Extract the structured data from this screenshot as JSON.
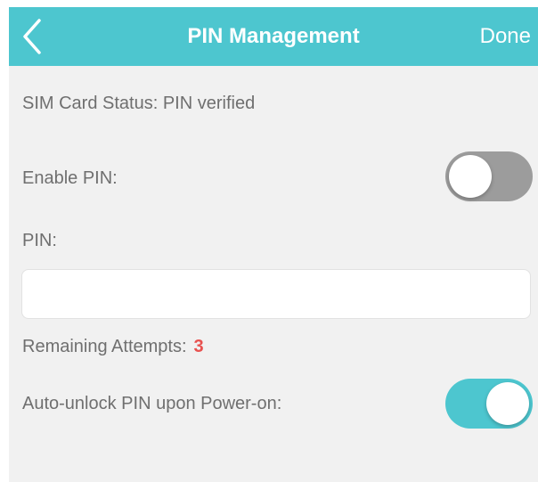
{
  "header": {
    "title": "PIN Management",
    "done_label": "Done",
    "back_icon": "chevron-left-icon",
    "background_color": "#4dc6cf"
  },
  "sim_status": "SIM Card Status: PIN verified",
  "enable_pin": {
    "label": "Enable PIN:",
    "enabled": false
  },
  "pin": {
    "label": "PIN:",
    "value": "",
    "placeholder": ""
  },
  "remaining_attempts": {
    "label": "Remaining Attempts:",
    "count": "3",
    "count_color": "#e8514f"
  },
  "auto_unlock": {
    "label": "Auto-unlock PIN upon Power-on:",
    "enabled": true
  }
}
